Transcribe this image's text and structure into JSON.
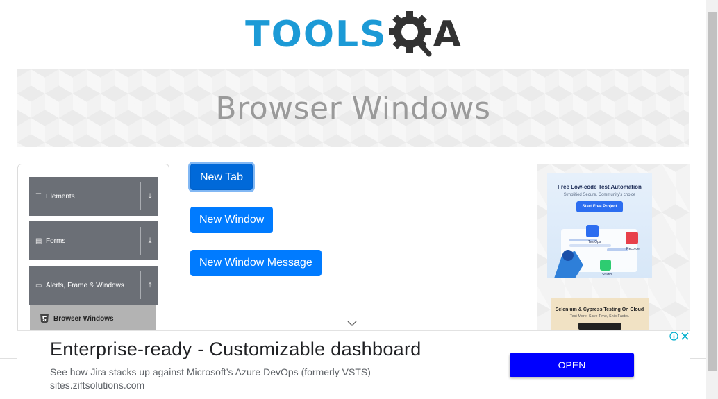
{
  "logo": {
    "text_tools": "TOOLS",
    "text_a": "A",
    "icon": "gear-magnifier-icon",
    "colors": {
      "blue": "#1c9ad6",
      "dark": "#333333"
    }
  },
  "banner": {
    "title": "Browser Windows"
  },
  "sidebar": {
    "groups": [
      {
        "label": "Elements",
        "icon": "hamburger-icon",
        "arrow": "download-arrow-icon"
      },
      {
        "label": "Forms",
        "icon": "document-icon",
        "arrow": "download-arrow-icon"
      },
      {
        "label": "Alerts, Frame & Windows",
        "icon": "window-icon",
        "arrow": "upload-arrow-icon"
      }
    ],
    "active_item": {
      "label": "Browser Windows",
      "icon": "html5-icon"
    }
  },
  "buttons": {
    "new_tab": "New Tab",
    "new_window": "New Window",
    "new_window_message": "New Window Message",
    "accent": "#007bff"
  },
  "side_ad": {
    "card1": {
      "title": "Free Low-code Test Automation",
      "subtitle": "Simplified Secure. Community's choice",
      "cta": "Start Free Project",
      "labels": [
        "TestOps",
        "Recorder",
        "Studio"
      ]
    },
    "card2": {
      "title": "Selenium & Cypress Testing On Cloud",
      "subtitle": "Test More, Save Time, Ship Faster."
    }
  },
  "bottom_ad": {
    "headline": "Enterprise-ready - Customizable dashboard",
    "description": "See how Jira stacks up against Microsoft’s Azure DevOps (formerly VSTS)",
    "domain": "sites.ziftsolutions.com",
    "cta": "OPEN",
    "cta_color": "#0000ff"
  }
}
